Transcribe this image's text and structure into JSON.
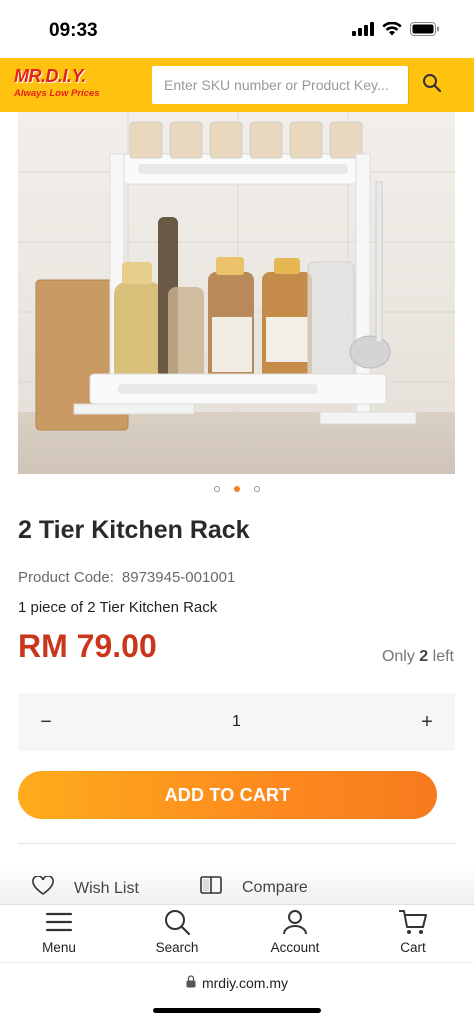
{
  "status": {
    "time": "09:33",
    "icons": [
      "signal-icon",
      "wifi-icon",
      "battery-icon"
    ]
  },
  "header": {
    "logo_text": "MR.D.I.Y.",
    "logo_tagline": "Always Low Prices",
    "search_placeholder": "Enter SKU number or Product Key...",
    "brand_color": "#ffc20e"
  },
  "gallery": {
    "image_count": 3,
    "active_index": 1
  },
  "product": {
    "title": "2 Tier Kitchen Rack",
    "code_label": "Product Code:",
    "code_value": "8973945-001001",
    "description": "1 piece of 2 Tier Kitchen Rack",
    "price": "RM 79.00",
    "price_color": "#c9361c",
    "stock_prefix": "Only",
    "stock_count": "2",
    "stock_suffix": "left"
  },
  "quantity": {
    "minus": "−",
    "value": "1",
    "plus": "+"
  },
  "add_to_cart": {
    "label": "ADD TO CART",
    "color": "#fd8a1e"
  },
  "actions": {
    "wishlist": "Wish List",
    "compare": "Compare"
  },
  "bottom_nav": {
    "menu": "Menu",
    "search": "Search",
    "account": "Account",
    "cart": "Cart"
  },
  "browser": {
    "url": "mrdiy.com.my"
  }
}
